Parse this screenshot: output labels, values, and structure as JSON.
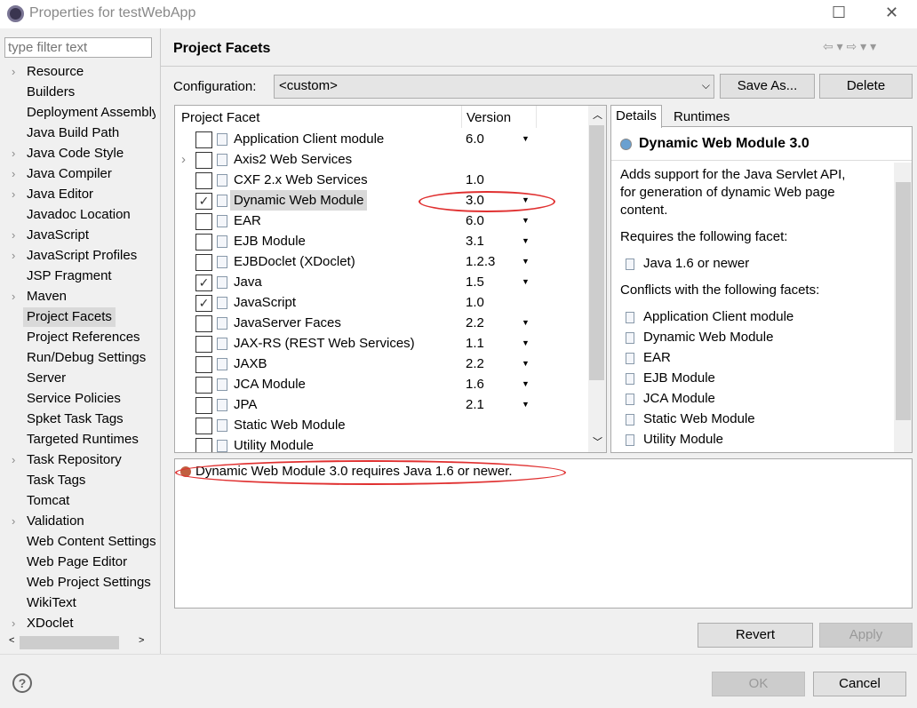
{
  "window": {
    "title": "Properties for testWebApp",
    "minimize": "—",
    "maximize": "☐",
    "close": "✕"
  },
  "sidebar": {
    "filter_placeholder": "type filter text",
    "items": [
      {
        "label": "Resource",
        "expandable": true
      },
      {
        "label": "Builders"
      },
      {
        "label": "Deployment Assembly"
      },
      {
        "label": "Java Build Path"
      },
      {
        "label": "Java Code Style",
        "expandable": true
      },
      {
        "label": "Java Compiler",
        "expandable": true
      },
      {
        "label": "Java Editor",
        "expandable": true
      },
      {
        "label": "Javadoc Location"
      },
      {
        "label": "JavaScript",
        "expandable": true
      },
      {
        "label": "JavaScript Profiles",
        "expandable": true
      },
      {
        "label": "JSP Fragment"
      },
      {
        "label": "Maven",
        "expandable": true
      },
      {
        "label": "Project Facets",
        "selected": true
      },
      {
        "label": "Project References"
      },
      {
        "label": "Run/Debug Settings"
      },
      {
        "label": "Server"
      },
      {
        "label": "Service Policies"
      },
      {
        "label": "Spket Task Tags"
      },
      {
        "label": "Targeted Runtimes"
      },
      {
        "label": "Task Repository",
        "expandable": true
      },
      {
        "label": "Task Tags"
      },
      {
        "label": "Tomcat"
      },
      {
        "label": "Validation",
        "expandable": true
      },
      {
        "label": "Web Content Settings"
      },
      {
        "label": "Web Page Editor"
      },
      {
        "label": "Web Project Settings"
      },
      {
        "label": "WikiText"
      },
      {
        "label": "XDoclet",
        "expandable": true
      }
    ]
  },
  "page": {
    "title": "Project Facets",
    "nav": "⇦ ▾ ⇨ ▾ ▾"
  },
  "config": {
    "label": "Configuration:",
    "value": "<custom>",
    "save_as": "Save As...",
    "delete": "Delete"
  },
  "facets": {
    "col_facet": "Project Facet",
    "col_version": "Version",
    "rows": [
      {
        "name": "Application Client module",
        "version": "6.0",
        "dropdown": true
      },
      {
        "name": "Axis2 Web Services",
        "version": "",
        "expandable": true
      },
      {
        "name": "CXF 2.x Web Services",
        "version": "1.0"
      },
      {
        "name": "Dynamic Web Module",
        "version": "3.0",
        "dropdown": true,
        "checked": true,
        "selected": true
      },
      {
        "name": "EAR",
        "version": "6.0",
        "dropdown": true
      },
      {
        "name": "EJB Module",
        "version": "3.1",
        "dropdown": true
      },
      {
        "name": "EJBDoclet (XDoclet)",
        "version": "1.2.3",
        "dropdown": true
      },
      {
        "name": "Java",
        "version": "1.5",
        "dropdown": true,
        "checked": true
      },
      {
        "name": "JavaScript",
        "version": "1.0",
        "checked": true
      },
      {
        "name": "JavaServer Faces",
        "version": "2.2",
        "dropdown": true
      },
      {
        "name": "JAX-RS (REST Web Services)",
        "version": "1.1",
        "dropdown": true
      },
      {
        "name": "JAXB",
        "version": "2.2",
        "dropdown": true
      },
      {
        "name": "JCA Module",
        "version": "1.6",
        "dropdown": true
      },
      {
        "name": "JPA",
        "version": "2.1",
        "dropdown": true
      },
      {
        "name": "Static Web Module",
        "version": ""
      },
      {
        "name": "Utility Module",
        "version": ""
      }
    ]
  },
  "details": {
    "tab_details": "Details",
    "tab_runtimes": "Runtimes",
    "heading": "Dynamic Web Module 3.0",
    "description": [
      "Adds support for the Java Servlet API,",
      "for generation of dynamic Web page",
      "content."
    ],
    "requires_label": "Requires the following facet:",
    "requires": [
      "Java 1.6 or newer"
    ],
    "conflicts_label": "Conflicts with the following facets:",
    "conflicts": [
      "Application Client module",
      "Dynamic Web Module",
      "EAR",
      "EJB Module",
      "JCA Module",
      "Static Web Module",
      "Utility Module"
    ]
  },
  "message": "Dynamic Web Module 3.0 requires Java 1.6 or newer.",
  "buttons": {
    "revert": "Revert",
    "apply": "Apply",
    "ok": "OK",
    "cancel": "Cancel",
    "help": "?"
  },
  "colors": {
    "annotation": "#e03030",
    "selection": "#d9d9d9"
  }
}
